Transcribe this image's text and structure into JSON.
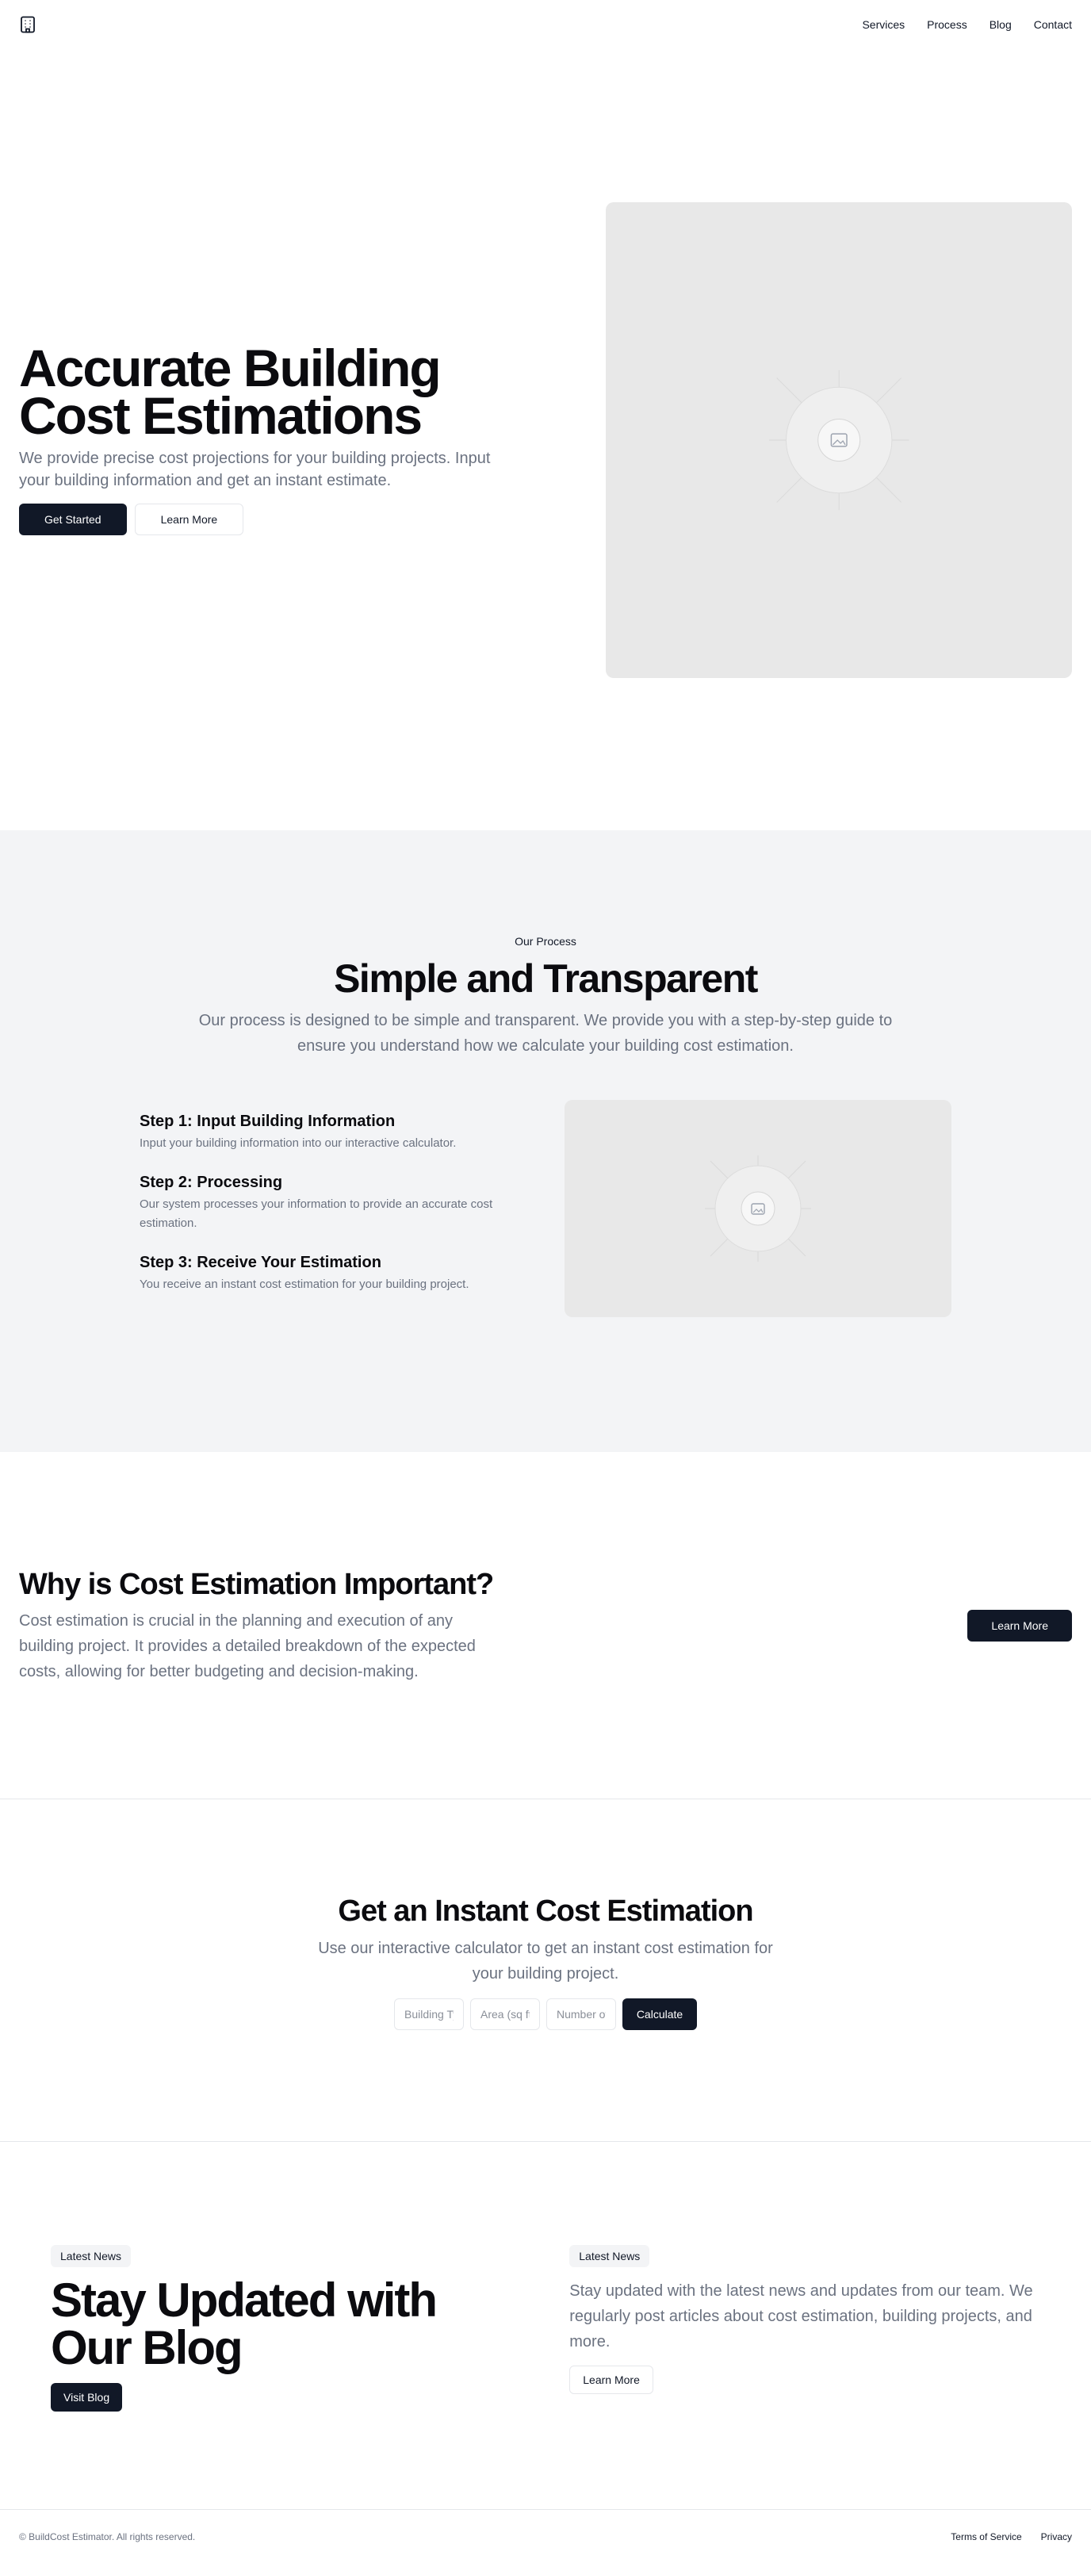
{
  "nav": {
    "logo_icon": "building-icon",
    "links": [
      "Services",
      "Process",
      "Blog",
      "Contact"
    ]
  },
  "hero": {
    "title": "Accurate Building Cost Estimations",
    "description": "We provide precise cost projections for your building projects. Input your building information and get an instant estimate.",
    "primary_button": "Get Started",
    "secondary_button": "Learn More",
    "image_icon": "image-placeholder-icon"
  },
  "process": {
    "eyebrow": "Our Process",
    "title": "Simple and Transparent",
    "description": "Our process is designed to be simple and transparent. We provide you with a step-by-step guide to ensure you understand how we calculate your building cost estimation.",
    "steps": [
      {
        "title": "Step 1: Input Building Information",
        "text": "Input your building information into our interactive calculator."
      },
      {
        "title": "Step 2: Processing",
        "text": "Our system processes your information to provide an accurate cost estimation."
      },
      {
        "title": "Step 3: Receive Your Estimation",
        "text": "You receive an instant cost estimation for your building project."
      }
    ]
  },
  "why": {
    "title": "Why is Cost Estimation Important?",
    "description": "Cost estimation is crucial in the planning and execution of any building project. It provides a detailed breakdown of the expected costs, allowing for better budgeting and decision-making.",
    "button": "Learn More"
  },
  "estimate": {
    "title": "Get an Instant Cost Estimation",
    "description": "Use our interactive calculator to get an instant cost estimation for your building project.",
    "fields": [
      {
        "placeholder": "Building Type"
      },
      {
        "placeholder": "Area (sq ft)"
      },
      {
        "placeholder": "Number of Floors"
      }
    ],
    "button": "Calculate"
  },
  "blog": {
    "left_badge": "Latest News",
    "title": "Stay Updated with Our Blog",
    "left_button": "Visit Blog",
    "right_badge": "Latest News",
    "description": "Stay updated with the latest news and updates from our team. We regularly post articles about cost estimation, building projects, and more.",
    "right_button": "Learn More"
  },
  "footer": {
    "copyright": "© BuildCost Estimator. All rights reserved.",
    "links": [
      "Terms of Service",
      "Privacy"
    ]
  },
  "colors": {
    "primary_dark": "#111827",
    "muted_text": "#6b7280",
    "section_bg": "#f3f4f6",
    "placeholder_bg": "#e8e8e8"
  }
}
